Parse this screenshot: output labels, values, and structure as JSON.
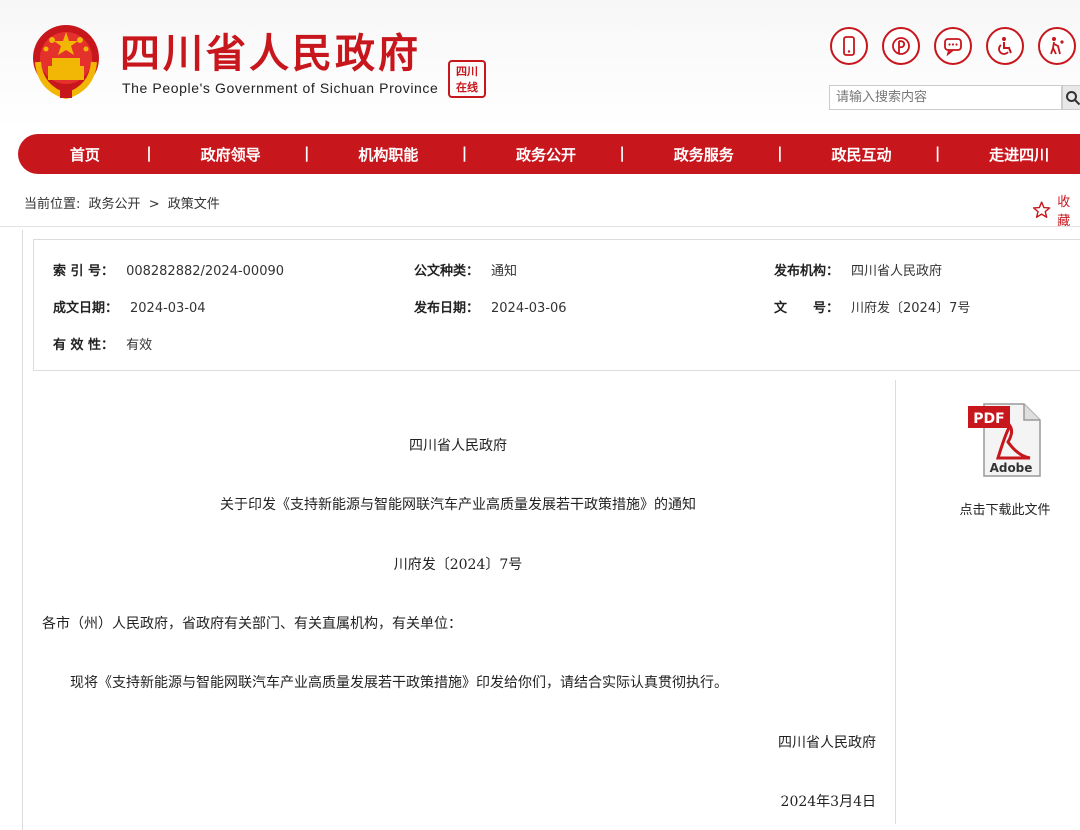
{
  "header": {
    "title": "四川省人民政府",
    "subtitle": "The People's Government of Sichuan Province",
    "seal_text": "四川在线",
    "icons": [
      "mobile-icon",
      "weibo-icon",
      "chat-icon",
      "accessibility-icon",
      "elderly-icon"
    ]
  },
  "search": {
    "placeholder": "请输入搜索内容"
  },
  "nav": {
    "items": [
      {
        "label": "首页"
      },
      {
        "label": "政府领导"
      },
      {
        "label": "机构职能"
      },
      {
        "label": "政务公开"
      },
      {
        "label": "政务服务"
      },
      {
        "label": "政民互动"
      },
      {
        "label": "走进四川"
      }
    ],
    "separator": "|"
  },
  "breadcrumb": {
    "prefix": "当前位置:",
    "items": [
      "政务公开",
      "政策文件"
    ],
    "sep": ">"
  },
  "favorite": {
    "label": "收藏"
  },
  "meta": {
    "index_label": "索 引 号：",
    "index_value": "008282882/2024-00090",
    "doc_type_label": "公文种类：",
    "doc_type_value": "通知",
    "issuer_label": "发布机构：",
    "issuer_value": "四川省人民政府",
    "created_label": "成文日期：",
    "created_value": "2024-03-04",
    "published_label": "发布日期：",
    "published_value": "2024-03-06",
    "number_label": "文　　号：",
    "number_value": "川府发〔2024〕7号",
    "validity_label": "有 效 性：",
    "validity_value": "有效"
  },
  "document": {
    "org": "四川省人民政府",
    "title": "关于印发《支持新能源与智能网联汽车产业高质量发展若干政策措施》的通知",
    "doc_number": "川府发〔2024〕7号",
    "salutation": "各市（州）人民政府，省政府有关部门、有关直属机构，有关单位：",
    "body": "现将《支持新能源与智能网联汽车产业高质量发展若干政策措施》印发给你们，请结合实际认真贯彻执行。",
    "signature": "四川省人民政府",
    "date": "2024年3月4日"
  },
  "download": {
    "pdf_text": "PDF",
    "adobe_text": "Adobe",
    "label": "点击下载此文件"
  },
  "colors": {
    "brand_red": "#c8161d"
  }
}
